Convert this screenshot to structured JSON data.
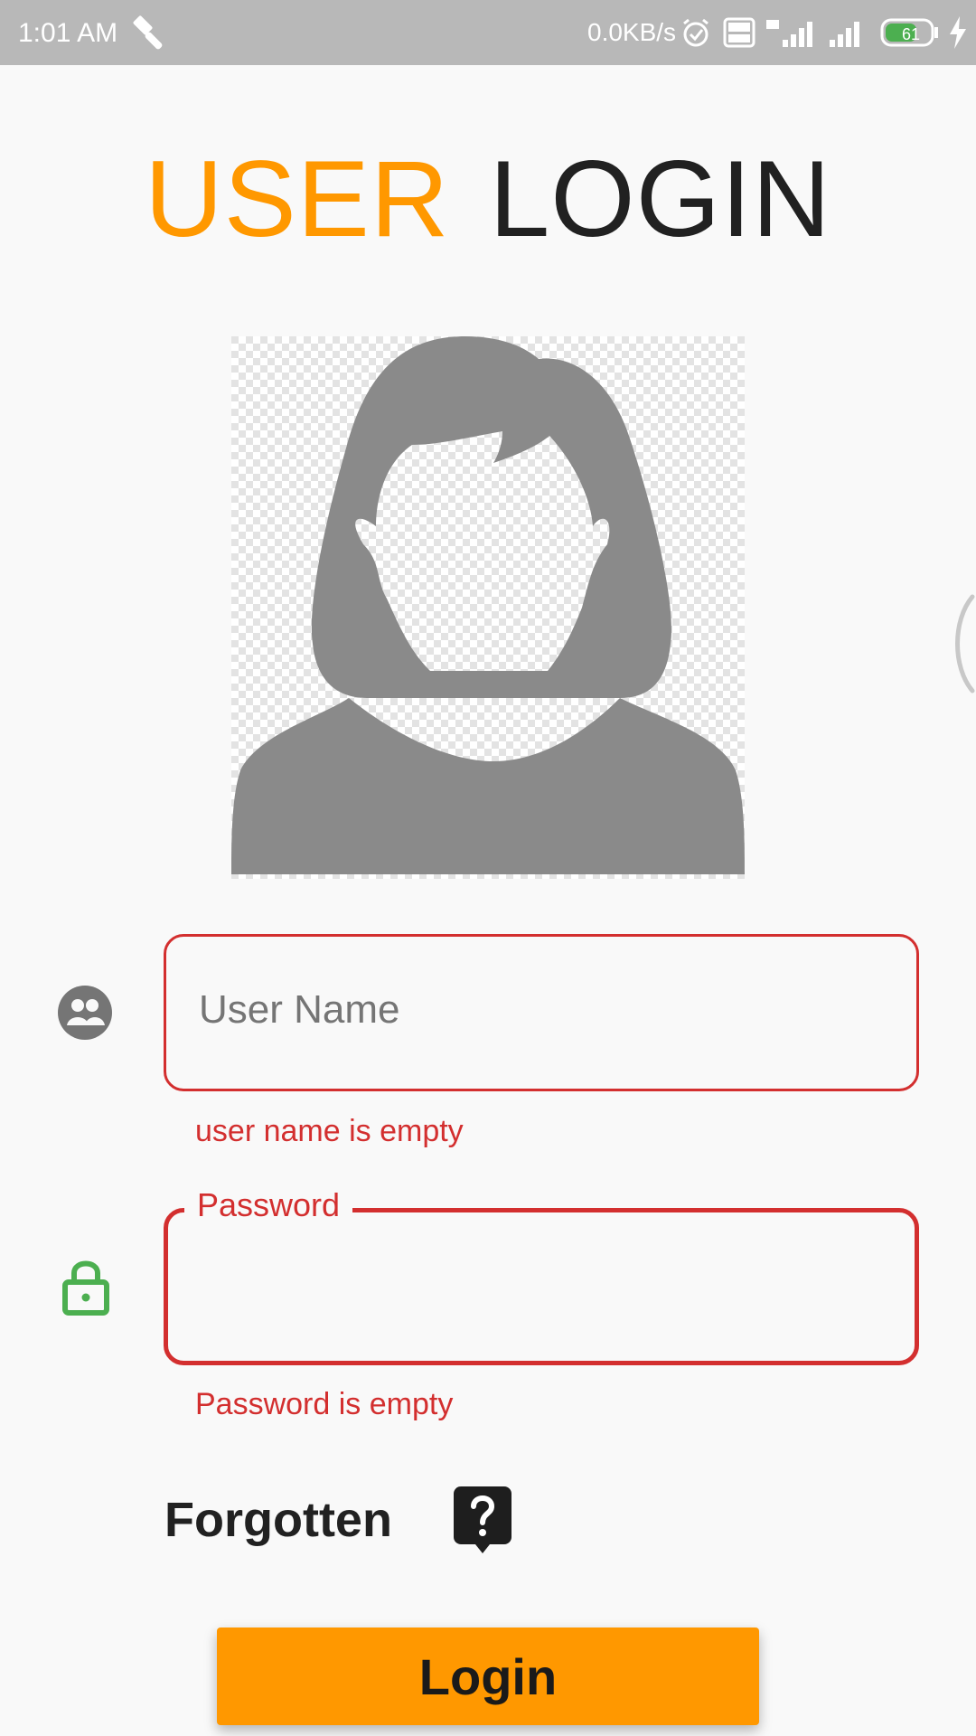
{
  "status_bar": {
    "time": "1:01 AM",
    "network_speed": "0.0KB/s",
    "battery_level": "61",
    "icons": [
      "wrench-icon",
      "alarm-icon",
      "volte-icon",
      "signal-4g-icon",
      "signal-icon",
      "battery-icon",
      "charging-icon"
    ]
  },
  "title": {
    "part1": "USER",
    "part2": "LOGIN"
  },
  "username": {
    "placeholder": "User Name",
    "value": "",
    "error": "user name is empty"
  },
  "password": {
    "label": "Password",
    "value": "",
    "error": "Password is empty"
  },
  "forgotten": {
    "label": "Forgotten"
  },
  "login_button": {
    "label": "Login"
  },
  "colors": {
    "accent": "#ff9800",
    "error": "#d32f2f",
    "lock_icon": "#4caf50",
    "status_bar": "#b8b8b8",
    "avatar": "#8a8a8a"
  }
}
